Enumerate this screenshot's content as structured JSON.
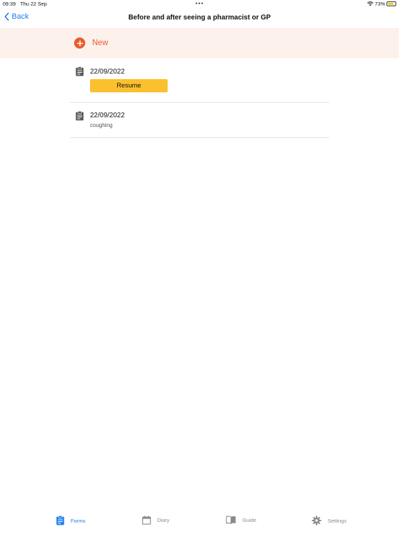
{
  "status_bar": {
    "time": "09:39",
    "date": "Thu 22 Sep",
    "battery": "73%"
  },
  "nav": {
    "back_label": "Back",
    "title": "Before and after seeing a pharmacist or GP"
  },
  "new_button": {
    "label": "New"
  },
  "entries": [
    {
      "date": "22/09/2022",
      "action_label": "Resume"
    },
    {
      "date": "22/09/2022",
      "note": "coughing"
    }
  ],
  "tabs": [
    {
      "label": "Forms",
      "icon": "clipboard-icon",
      "active": true
    },
    {
      "label": "Diary",
      "icon": "calendar-icon",
      "active": false
    },
    {
      "label": "Guide",
      "icon": "book-icon",
      "active": false
    },
    {
      "label": "Settings",
      "icon": "gear-icon",
      "active": false
    }
  ],
  "colors": {
    "accent": "#1a7df0",
    "new_orange": "#ec5a2b",
    "new_bar_bg": "#fdf1ec",
    "resume_yellow": "#fbc02d"
  }
}
